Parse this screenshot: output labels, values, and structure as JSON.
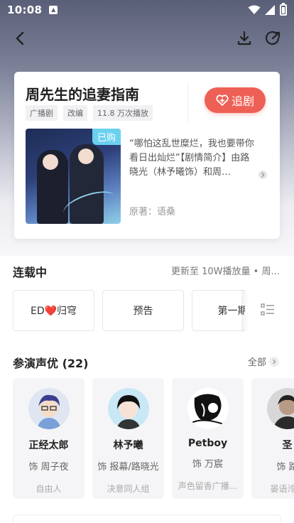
{
  "status_bar": {
    "time": "10:08"
  },
  "drama": {
    "title": "周先生的追妻指南",
    "tags": [
      "广播剧",
      "改编",
      "11.8 万次播放"
    ],
    "follow_label": "追剧",
    "purchased_badge": "已购",
    "synopsis": "“哪怕这乱世糜烂，我也要带你看日出灿烂”【剧情简介】由路晓光（林予曦饰）和周…",
    "author": "原著：语桑"
  },
  "serial": {
    "title": "连载中",
    "status": "更新至 10W播放量 • 周..."
  },
  "episodes": [
    "ED❤️归穹",
    "预告",
    "第一期"
  ],
  "cast": {
    "title": "参演声优 (22)",
    "all_label": "全部",
    "members": [
      {
        "name": "正经太郎",
        "role": "饰 周子夜",
        "group": "自由人"
      },
      {
        "name": "林予曦",
        "role": "饰 报幕/路晓光",
        "group": "决意同人组"
      },
      {
        "name": "Petboy",
        "role": "饰 万宸",
        "group": "声色留香广播..."
      },
      {
        "name": "圣",
        "role": "饰 路",
        "group": "晏语泠然"
      }
    ]
  },
  "colors": {
    "accent": "#ee6055",
    "badge": "#6ad1ef"
  }
}
